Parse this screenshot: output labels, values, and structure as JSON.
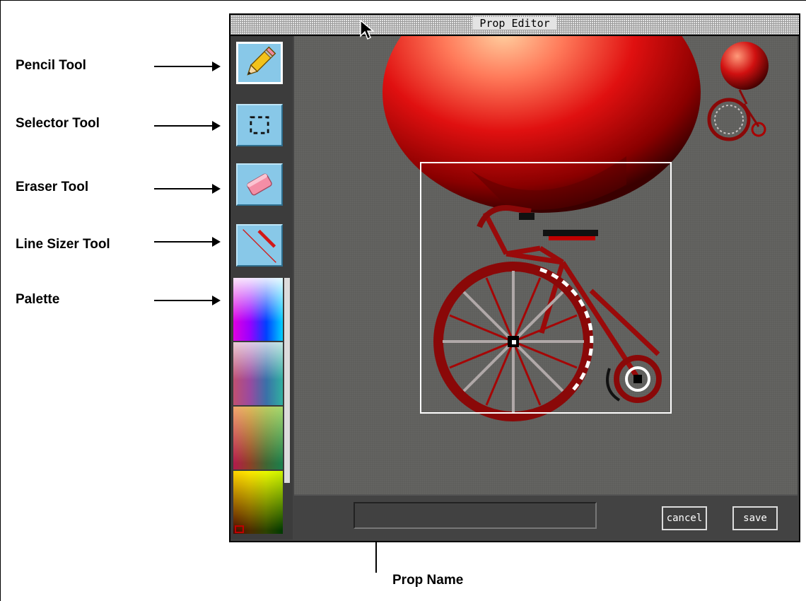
{
  "window": {
    "title": "Prop Editor"
  },
  "callouts": {
    "pencil": "Pencil Tool",
    "selector": "Selector Tool",
    "eraser": "Eraser Tool",
    "line_sizer": "Line Sizer Tool",
    "palette": "Palette",
    "prop_name": "Prop Name"
  },
  "tools": [
    {
      "name": "pencil",
      "icon": "pencil-icon",
      "active": true
    },
    {
      "name": "selector",
      "icon": "selection-marquee-icon",
      "active": false
    },
    {
      "name": "eraser",
      "icon": "eraser-icon",
      "active": false
    },
    {
      "name": "line-sizer",
      "icon": "line-size-icon",
      "active": false
    }
  ],
  "prop_name": {
    "value": ""
  },
  "buttons": {
    "cancel": "cancel",
    "save": "save"
  },
  "colors": {
    "tool_button": "#88c8e8",
    "canvas": "#5f5f5c",
    "window": "#444444",
    "selection": "#ffffff",
    "artwork_red": "#c81010"
  }
}
